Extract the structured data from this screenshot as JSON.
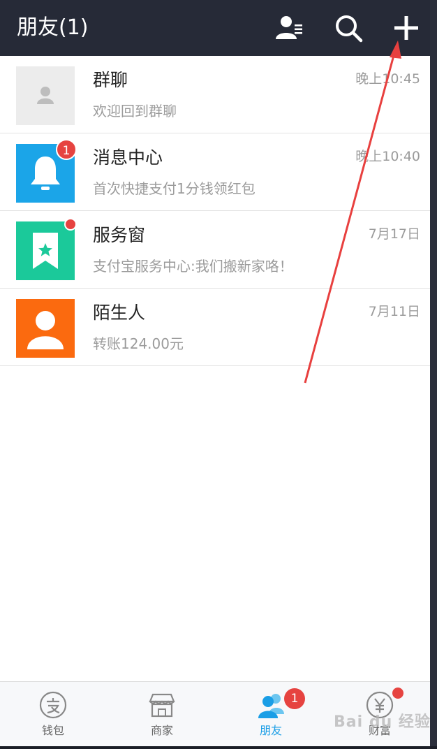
{
  "header": {
    "title": "朋友(1)",
    "icons": [
      "contacts-icon",
      "search-icon",
      "add-icon"
    ]
  },
  "conversations": [
    {
      "name": "群聊",
      "message": "欢迎回到群聊",
      "time": "晚上10:45",
      "avatar": "group-avatar-placeholder",
      "avatar_color": "#ececec"
    },
    {
      "name": "消息中心",
      "message": "首次快捷支付1分钱领红包",
      "time": "晚上10:40",
      "avatar": "bell-icon",
      "avatar_color": "#1ba5e8",
      "badge": "1"
    },
    {
      "name": "服务窗",
      "message": "支付宝服务中心:我们搬新家咯！",
      "time": "7月17日",
      "avatar": "bookmark-star-icon",
      "avatar_color": "#1bc99a",
      "dot": true
    },
    {
      "name": "陌生人",
      "message": "转账124.00元",
      "time": "7月11日",
      "avatar": "person-icon",
      "avatar_color": "#fb6a0f"
    }
  ],
  "tabbar": {
    "tabs": [
      {
        "label": "钱包",
        "icon": "wallet-icon"
      },
      {
        "label": "商家",
        "icon": "store-icon"
      },
      {
        "label": "朋友",
        "icon": "friends-icon",
        "badge": "1",
        "active": true
      },
      {
        "label": "财富",
        "icon": "wealth-icon",
        "dot": true
      }
    ]
  },
  "watermark": "Bai du 经验",
  "colors": {
    "header_bg": "#262a37",
    "accent": "#1a9ee6",
    "badge": "#e64340",
    "annotation_arrow": "#e8403f"
  }
}
